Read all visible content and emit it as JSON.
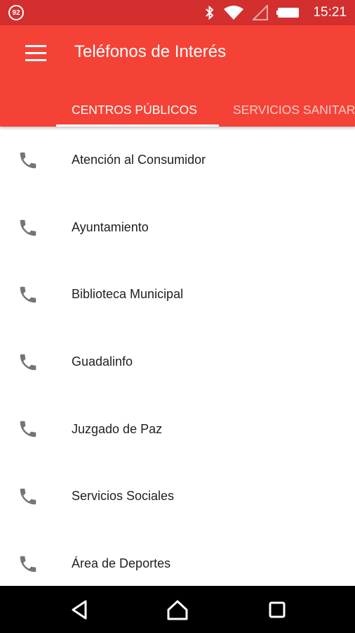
{
  "status_bar": {
    "notification_badge": "92",
    "time": "15:21",
    "icons": [
      "bluetooth-icon",
      "wifi-icon",
      "signal-icon",
      "battery-icon"
    ]
  },
  "toolbar": {
    "title": "Teléfonos de Interés",
    "menu_icon": "hamburger-menu-icon",
    "background_color": "#f44336"
  },
  "tabs": [
    {
      "label": "CENTROS PÚBLICOS",
      "selected": true
    },
    {
      "label": "SERVICIOS SANITARIOS",
      "selected": false
    }
  ],
  "list": {
    "item_icon": "phone-icon",
    "items": [
      {
        "label": "Atención al Consumidor"
      },
      {
        "label": "Ayuntamiento"
      },
      {
        "label": "Biblioteca Municipal"
      },
      {
        "label": "Guadalinfo"
      },
      {
        "label": "Juzgado de Paz"
      },
      {
        "label": "Servicios Sociales"
      },
      {
        "label": "Área de Deportes"
      }
    ]
  },
  "nav_bar": {
    "buttons": [
      "back-icon",
      "home-icon",
      "recents-icon"
    ]
  }
}
